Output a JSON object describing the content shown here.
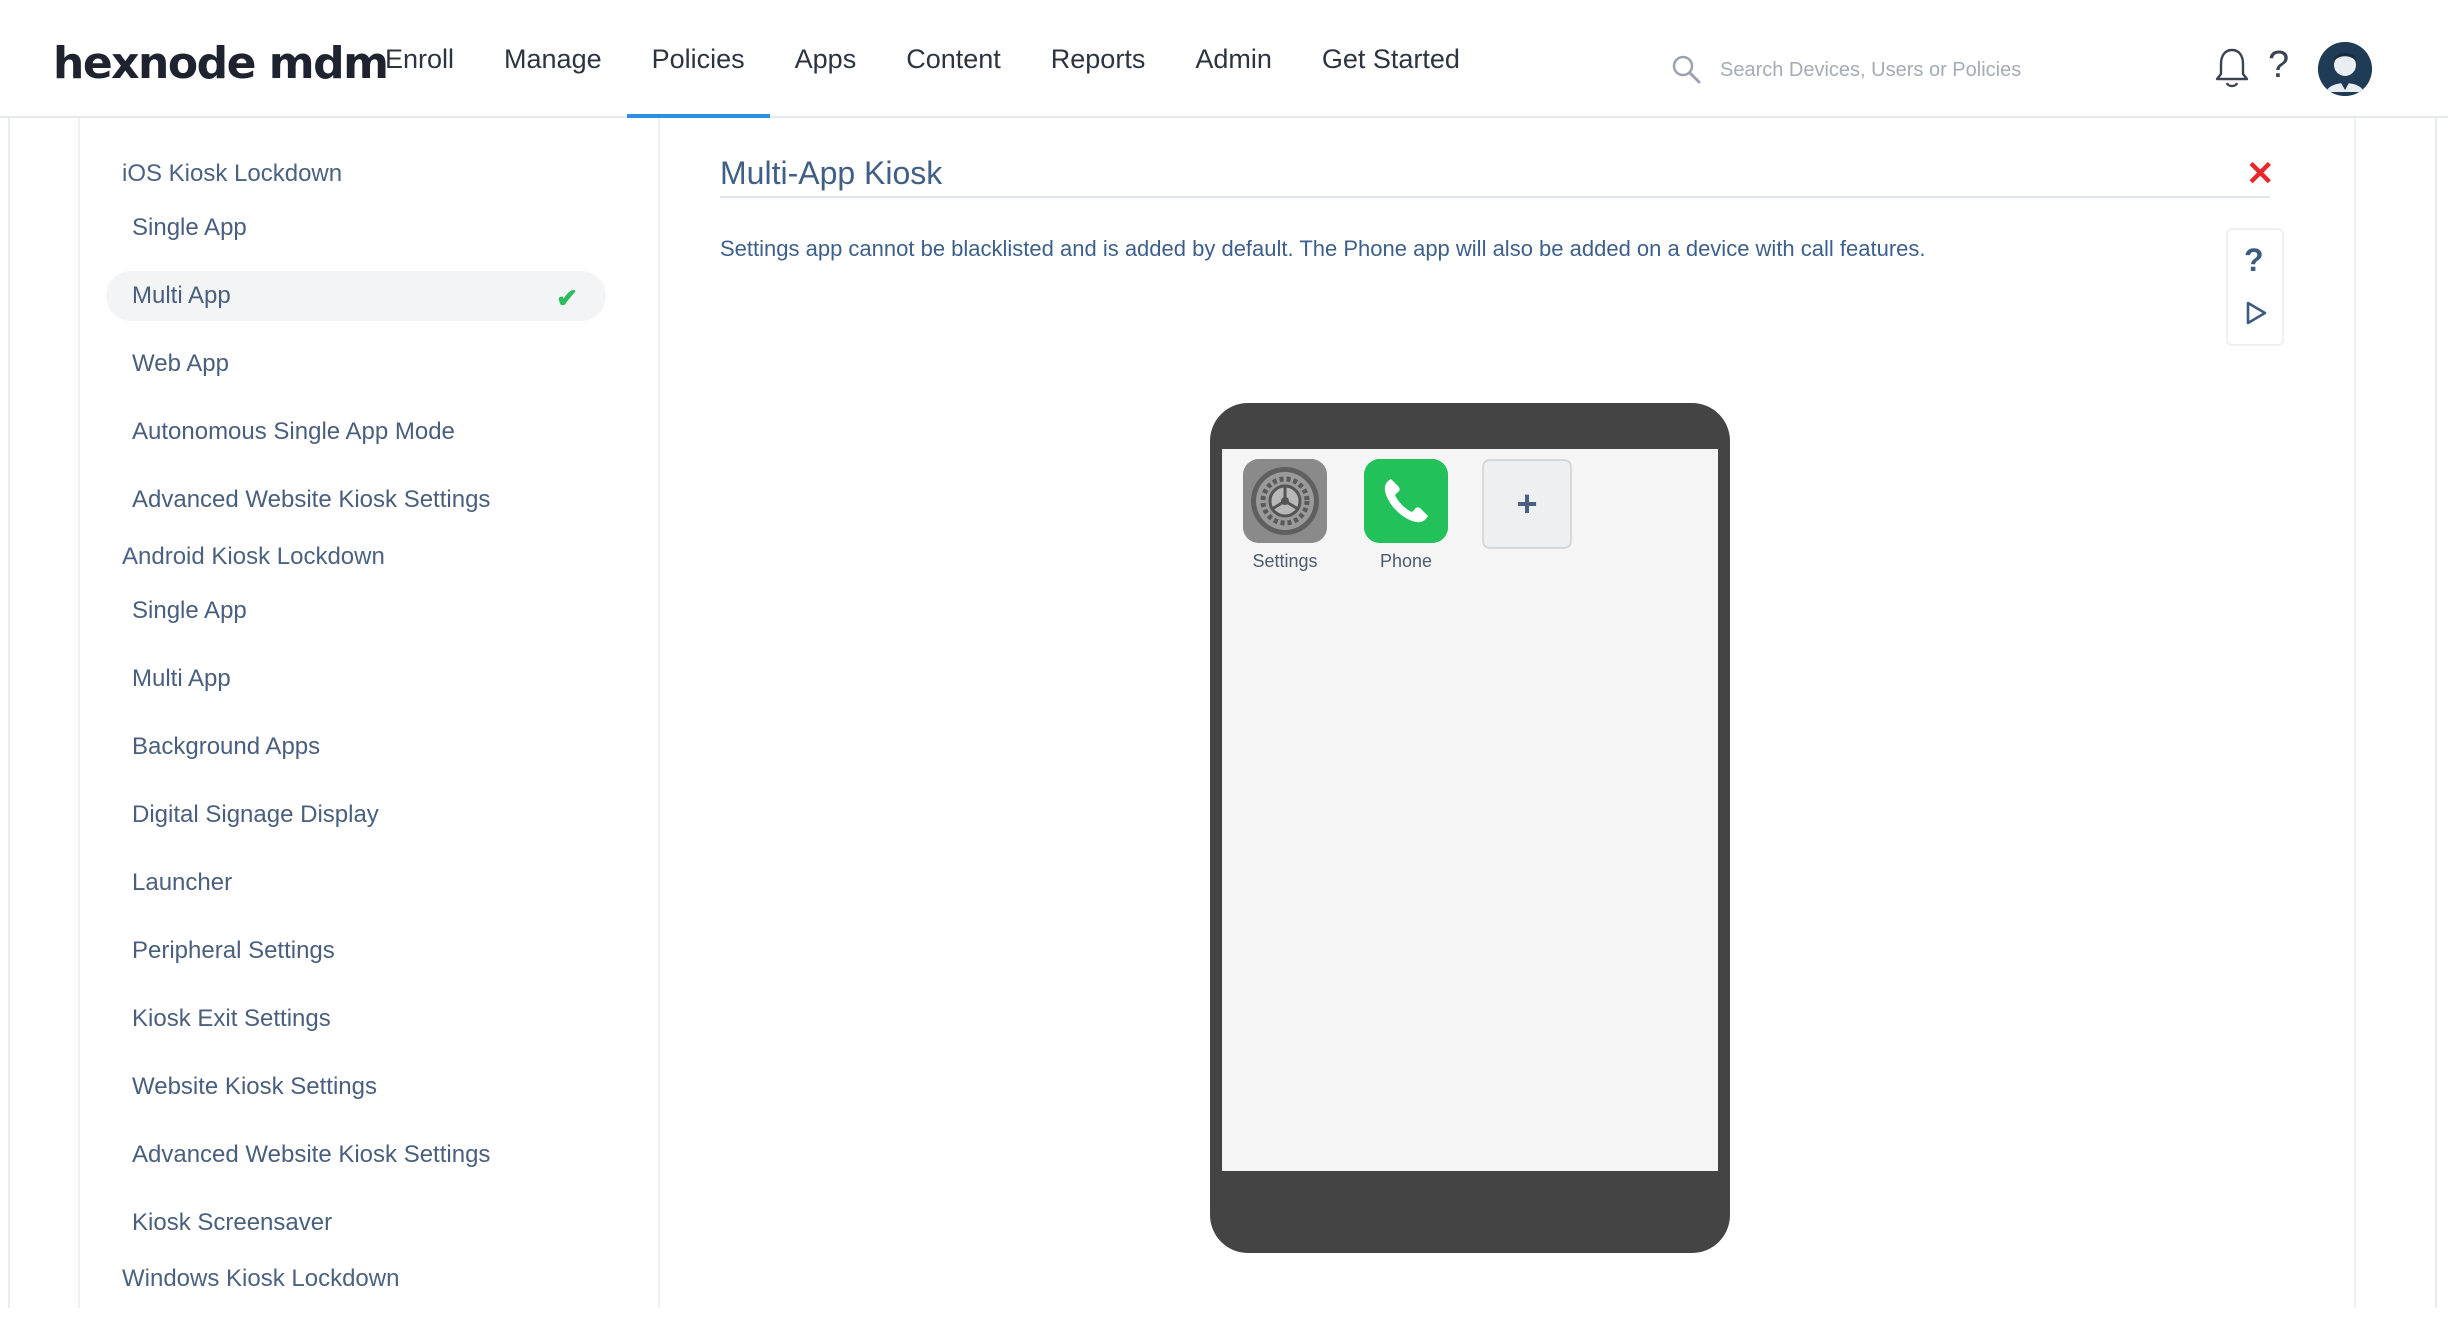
{
  "header": {
    "logo": "hexnode mdm",
    "nav": [
      "Enroll",
      "Manage",
      "Policies",
      "Apps",
      "Content",
      "Reports",
      "Admin",
      "Get Started"
    ],
    "active_nav": "Policies",
    "search_placeholder": "Search Devices, Users or Policies",
    "help_glyph": "?",
    "icons": [
      "search-icon",
      "bell-icon",
      "help-icon",
      "avatar"
    ]
  },
  "sidebar": {
    "ios_title": "iOS Kiosk Lockdown",
    "ios_items": [
      "Single App",
      "Multi App",
      "Web App",
      "Autonomous Single App Mode",
      "Advanced Website Kiosk Settings"
    ],
    "selected_item": "Multi App",
    "android_title": "Android Kiosk Lockdown",
    "android_items": [
      "Single App",
      "Multi App",
      "Background Apps",
      "Digital Signage Display",
      "Launcher",
      "Peripheral Settings",
      "Kiosk Exit Settings",
      "Website Kiosk Settings",
      "Advanced Website Kiosk Settings",
      "Kiosk Screensaver"
    ],
    "windows_title": "Windows Kiosk Lockdown"
  },
  "main": {
    "title": "Multi-App Kiosk",
    "close_glyph": "✕",
    "description": "Settings app cannot be blacklisted and is added by default. The Phone app will also be added on a device with call features.",
    "help_glyph": "?",
    "apps": [
      {
        "label": "Settings",
        "icon": "settings-gear-icon"
      },
      {
        "label": "Phone",
        "icon": "phone-handset-icon"
      }
    ],
    "add_glyph": "+"
  },
  "colors": {
    "accent": "#2c8fe0",
    "close": "#e8282b",
    "check": "#2ebd5a",
    "phone_body": "#444444",
    "phone_app": "#23c159"
  }
}
